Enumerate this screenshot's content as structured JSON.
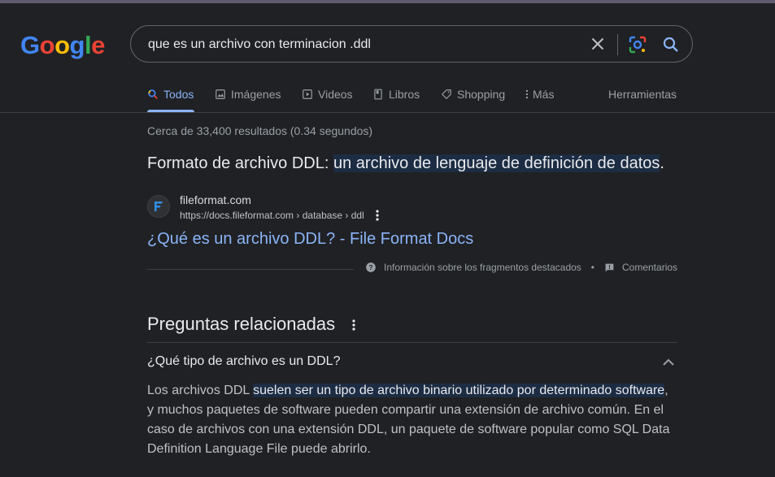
{
  "logo": {
    "letters": [
      "G",
      "o",
      "o",
      "g",
      "l",
      "e"
    ],
    "colors": [
      "#4285f4",
      "#ea4335",
      "#fbbc05",
      "#4285f4",
      "#34a853",
      "#ea4335"
    ]
  },
  "search": {
    "query": "que es un archivo con terminacion .ddl"
  },
  "tabs": [
    {
      "label": "Todos",
      "icon": "search-icon"
    },
    {
      "label": "Imágenes",
      "icon": "image-icon"
    },
    {
      "label": "Videos",
      "icon": "play-icon"
    },
    {
      "label": "Libros",
      "icon": "book-icon"
    },
    {
      "label": "Shopping",
      "icon": "tag-icon"
    },
    {
      "label": "Más",
      "icon": "more-vert-icon"
    }
  ],
  "tools_label": "Herramientas",
  "stats": "Cerca de 33,400 resultados (0.34 segundos)",
  "featured": {
    "title_prefix": "Formato de archivo DDL: ",
    "title_highlight": "un archivo de lenguaje de definición de datos",
    "title_suffix": ".",
    "site_name": "fileformat.com",
    "site_url": "https://docs.fileformat.com › database › ddl",
    "link_title": "¿Qué es un archivo DDL? - File Format Docs",
    "feedback_about": "Información sobre los fragmentos destacados",
    "feedback_comments": "Comentarios"
  },
  "paa": {
    "title": "Preguntas relacionadas",
    "question": "¿Qué tipo de archivo es un DDL?",
    "answer_prefix": "Los archivos DDL ",
    "answer_highlight": "suelen ser un tipo de archivo binario utilizado por determinado software",
    "answer_suffix": ", y muchos paquetes de software pueden compartir una extensión de archivo común. En el caso de archivos con una extensión DDL, un paquete de software popular como SQL Data Definition Language File puede abrirlo."
  },
  "colors": {
    "accent": "#8ab4f8",
    "background": "#202124"
  }
}
